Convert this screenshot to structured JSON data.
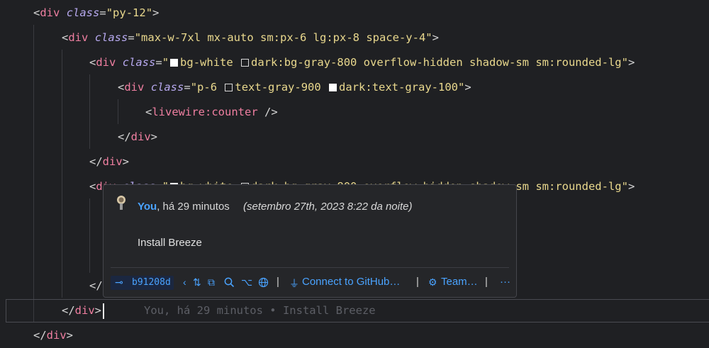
{
  "editor": {
    "lines": [
      {
        "id": "l1",
        "parts": [
          [
            "punc",
            "<"
          ],
          [
            "tag",
            "div"
          ],
          [
            "txt",
            " "
          ],
          [
            "attr",
            "class"
          ],
          [
            "punc",
            "="
          ],
          [
            "str",
            "\"py-12\""
          ],
          [
            "punc",
            ">"
          ]
        ]
      },
      {
        "id": "l2",
        "parts": [
          [
            "punc",
            "<"
          ],
          [
            "tag",
            "div"
          ],
          [
            "txt",
            " "
          ],
          [
            "attr",
            "class"
          ],
          [
            "punc",
            "="
          ],
          [
            "str",
            "\"max-w-7xl mx-auto sm:px-6 lg:px-8 space-y-4\""
          ],
          [
            "punc",
            ">"
          ]
        ]
      },
      {
        "id": "l3",
        "parts": [
          [
            "punc",
            "<"
          ],
          [
            "tag",
            "div"
          ],
          [
            "txt",
            " "
          ],
          [
            "attr",
            "class"
          ],
          [
            "punc",
            "="
          ],
          [
            "str",
            "\""
          ],
          [
            "swatch",
            "w"
          ],
          [
            "str",
            "bg-white "
          ],
          [
            "swatch",
            "o"
          ],
          [
            "str",
            "dark:bg-gray-800 overflow-hidden shadow-sm sm:rounded-lg\""
          ],
          [
            "punc",
            ">"
          ]
        ]
      },
      {
        "id": "l4",
        "parts": [
          [
            "punc",
            "<"
          ],
          [
            "tag",
            "div"
          ],
          [
            "txt",
            " "
          ],
          [
            "attr",
            "class"
          ],
          [
            "punc",
            "="
          ],
          [
            "str",
            "\"p-6 "
          ],
          [
            "swatch",
            "o"
          ],
          [
            "str",
            "text-gray-900 "
          ],
          [
            "swatch",
            "w"
          ],
          [
            "str",
            "dark:text-gray-100\""
          ],
          [
            "punc",
            ">"
          ]
        ]
      },
      {
        "id": "l5",
        "parts": [
          [
            "punc",
            "<"
          ],
          [
            "tag",
            "livewire:counter"
          ],
          [
            "txt",
            " "
          ],
          [
            "punc",
            "/>"
          ]
        ]
      },
      {
        "id": "l6",
        "parts": [
          [
            "punc",
            "</"
          ],
          [
            "tag",
            "div"
          ],
          [
            "punc",
            ">"
          ]
        ]
      },
      {
        "id": "l7",
        "parts": [
          [
            "punc",
            "</"
          ],
          [
            "tag",
            "div"
          ],
          [
            "punc",
            ">"
          ]
        ]
      },
      {
        "id": "l8",
        "parts": [
          [
            "punc",
            "<"
          ],
          [
            "tag",
            "div"
          ],
          [
            "txt",
            " "
          ],
          [
            "attr",
            "class"
          ],
          [
            "punc",
            "="
          ],
          [
            "str",
            "\""
          ],
          [
            "swatch",
            "w"
          ],
          [
            "str",
            "bg-white "
          ],
          [
            "swatch",
            "o"
          ],
          [
            "str",
            "dark:bg-gray-800 overflow-hidden shadow-sm sm:rounded-lg\""
          ],
          [
            "punc",
            ">"
          ]
        ]
      },
      {
        "id": "l9",
        "parts": [
          [
            "punc",
            "</"
          ]
        ]
      },
      {
        "id": "l10",
        "parts": [
          [
            "punc",
            "</"
          ],
          [
            "tag",
            "div"
          ],
          [
            "punc",
            ">"
          ]
        ]
      },
      {
        "id": "l11",
        "parts": [
          [
            "punc",
            "</"
          ],
          [
            "tag",
            "div"
          ],
          [
            "punc",
            ">"
          ]
        ]
      }
    ],
    "ghost_blame": "You, há 29 minutos • Install Breeze"
  },
  "hover": {
    "author_name": "You",
    "author_rest": ", há 29 minutos",
    "date": "(setembro 27th, 2023 8:22 da noite)",
    "message": "Install Breeze",
    "commit_hash": "b91208d",
    "connect_label": "Connect to GitHub…",
    "team_label": "Team…",
    "more_label": "···",
    "separator": "|",
    "icons": [
      "commit-icon",
      "previous-icon",
      "compare-icon",
      "changes-icon",
      "search-icon",
      "graph-icon",
      "globe-icon",
      "plug-icon",
      "team-icon"
    ]
  },
  "colors": {
    "background": "#1f2023",
    "tag": "#f07fa1",
    "attribute": "#b7a9ef",
    "string": "#e9d88d",
    "link": "#4aa3ff"
  }
}
